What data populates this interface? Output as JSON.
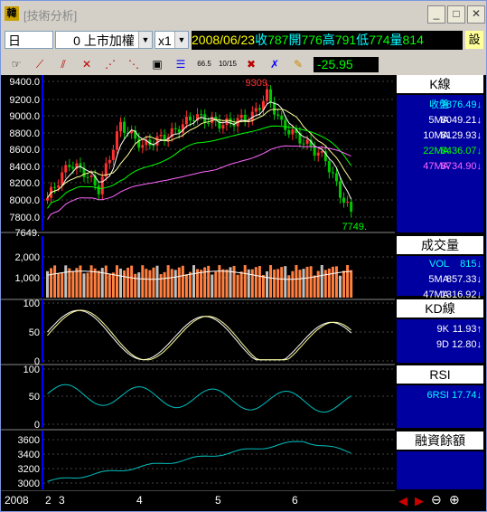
{
  "window": {
    "title": "[技術分析]",
    "icon_char": "韓"
  },
  "toolbar": {
    "period": "日",
    "index_code": "0",
    "index_name": "上市加權",
    "zoom": "x1",
    "date": "2008/06/23",
    "quote": [
      {
        "label": "收",
        "value": "787"
      },
      {
        "label": "開",
        "value": "776"
      },
      {
        "label": "高",
        "value": "791"
      },
      {
        "label": "低",
        "value": "774"
      },
      {
        "label": "量",
        "value": "814"
      }
    ],
    "trailing_button": "設",
    "change": "-25.95",
    "tool_icons": [
      "hand-icon",
      "draw-line-icon",
      "draw-channel-icon",
      "fibonacci-icon",
      "fan-lines-icon",
      "speed-lines-icon",
      "select-box-icon",
      "gann-icon",
      "fib-618-icon",
      "fib-1015-icon",
      "delete-drawing-icon",
      "cross-tool-icon",
      "pen-icon"
    ]
  },
  "k_panel": {
    "title": "K線",
    "lines": [
      {
        "label": "收盤",
        "value": "7876.49",
        "arrow": "↓",
        "color": "#00ffff"
      },
      {
        "label": "5MA",
        "value": "8049.21",
        "arrow": "↓",
        "color": "#ffffff"
      },
      {
        "label": "10MA",
        "value": "8129.93",
        "arrow": "↓",
        "color": "#ffffff"
      },
      {
        "label": "22MA",
        "value": "8436.07",
        "arrow": "↓",
        "color": "#00ff00"
      },
      {
        "label": "47MA",
        "value": "8734.90",
        "arrow": "↓",
        "color": "#ff66ff"
      }
    ],
    "high_mark": "9309.",
    "low_mark": "7749.",
    "y_ticks": [
      "9400.0",
      "9200.0",
      "9000.0",
      "8800.0",
      "8600.0",
      "8400.0",
      "8200.0",
      "8000.0",
      "7800.0",
      "7649."
    ]
  },
  "vol_panel": {
    "title": "成交量",
    "lines": [
      {
        "label": "VOL",
        "value": "815",
        "arrow": "↓",
        "color": "#00ffff"
      },
      {
        "label": "5MA",
        "value": "857.33",
        "arrow": "↓",
        "color": "#ffffff"
      },
      {
        "label": "47MA",
        "value": "1316.92",
        "arrow": "↓",
        "color": "#ffffff"
      }
    ],
    "y_ticks": [
      "2,000",
      "1,000"
    ]
  },
  "kd_panel": {
    "title": "KD線",
    "lines": [
      {
        "label": "9K",
        "value": "11.93",
        "arrow": "↑",
        "color": "#ffffff"
      },
      {
        "label": "9D",
        "value": "12.80",
        "arrow": "↓",
        "color": "#ffffff"
      }
    ],
    "y_ticks": [
      "100",
      "50",
      "0"
    ]
  },
  "rsi_panel": {
    "title": "RSI",
    "lines": [
      {
        "label": "6RSI",
        "value": "17.74",
        "arrow": "↓",
        "color": "#00ffff"
      }
    ],
    "y_ticks": [
      "100",
      "50",
      "0"
    ]
  },
  "margin_panel": {
    "title": "融資餘額",
    "y_ticks": [
      "3600",
      "3400",
      "3200",
      "3000"
    ]
  },
  "x_axis": {
    "labels": [
      "2008",
      "2",
      "3",
      "4",
      "5",
      "6"
    ]
  }
}
